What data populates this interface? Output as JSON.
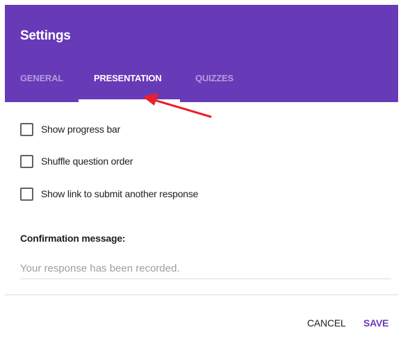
{
  "dialog": {
    "title": "Settings",
    "tabs": [
      {
        "label": "GENERAL",
        "active": false
      },
      {
        "label": "PRESENTATION",
        "active": true
      },
      {
        "label": "QUIZZES",
        "active": false
      }
    ]
  },
  "presentation": {
    "options": [
      {
        "label": "Show progress bar",
        "checked": false
      },
      {
        "label": "Shuffle question order",
        "checked": false
      },
      {
        "label": "Show link to submit another response",
        "checked": false
      }
    ],
    "confirmation": {
      "label": "Confirmation message:",
      "value": "",
      "placeholder": "Your response has been recorded."
    }
  },
  "footer": {
    "cancel_label": "CANCEL",
    "save_label": "SAVE"
  },
  "colors": {
    "accent": "#673ab7",
    "annotation_arrow": "#e8202a"
  },
  "annotation": {
    "icon": "red-arrow-icon"
  }
}
